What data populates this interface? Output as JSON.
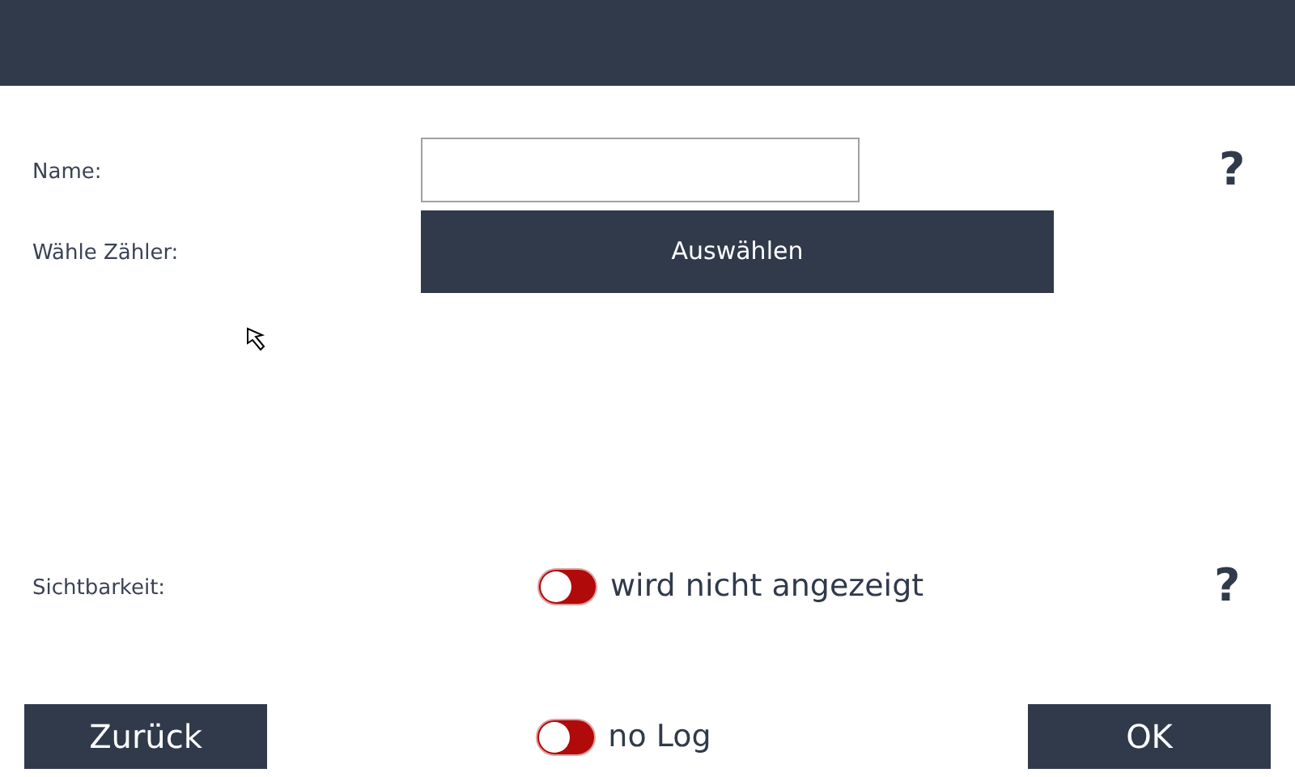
{
  "fields": [
    {
      "kind": "input",
      "label": "Name:",
      "help": "?"
    },
    {
      "kind": "button",
      "label": "Wähle Zähler:",
      "button": "Auswählen"
    }
  ],
  "visibility": {
    "label": "Sichtbarkeit:",
    "on": false,
    "text": "wird nicht angezeigt",
    "help": "?"
  },
  "footer": {
    "back": "Zurück",
    "log": {
      "on": false,
      "text": "no Log"
    },
    "ok": "OK"
  }
}
